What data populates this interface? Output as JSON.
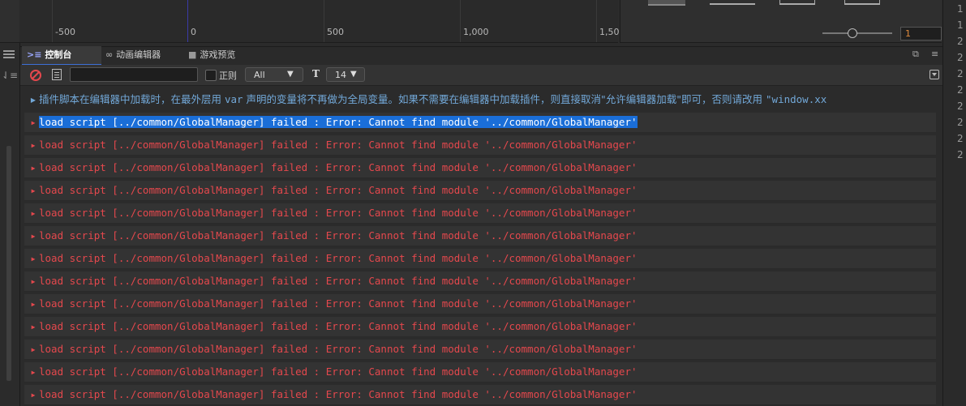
{
  "timeline": {
    "ticks": [
      "-500",
      "0",
      "500",
      "1,000",
      "1,50"
    ]
  },
  "right_panel": {
    "value": "1"
  },
  "right_gutter": {
    "numbers": [
      "1",
      "1",
      "2",
      "2",
      "2",
      "2",
      "2",
      "2",
      "2",
      "2"
    ]
  },
  "tabs": [
    {
      "label": "控制台",
      "icon": "console-icon"
    },
    {
      "label": "动画编辑器",
      "icon": "animation-icon"
    },
    {
      "label": "游戏预览",
      "icon": "video-icon"
    }
  ],
  "toolbar": {
    "filter_value": "",
    "regex_label": "正则",
    "level_value": "All",
    "fontsize_value": "14"
  },
  "log": {
    "info_prefix": "插件脚本在编辑器中加载时，在最外层用 ",
    "info_code": "var",
    "info_suffix": " 声明的变量将不再做为全局变量。如果不需要在编辑器中加载插件，则直接取消\"允许编辑器加载\"即可，否则请改用 ",
    "info_tail": "\"window.xx",
    "errors": [
      "load script [../common/GlobalManager] failed : Error: Cannot find module '../common/GlobalManager'",
      "load script [../common/GlobalManager] failed : Error: Cannot find module '../common/GlobalManager'",
      "load script [../common/GlobalManager] failed : Error: Cannot find module '../common/GlobalManager'",
      "load script [../common/GlobalManager] failed : Error: Cannot find module '../common/GlobalManager'",
      "load script [../common/GlobalManager] failed : Error: Cannot find module '../common/GlobalManager'",
      "load script [../common/GlobalManager] failed : Error: Cannot find module '../common/GlobalManager'",
      "load script [../common/GlobalManager] failed : Error: Cannot find module '../common/GlobalManager'",
      "load script [../common/GlobalManager] failed : Error: Cannot find module '../common/GlobalManager'",
      "load script [../common/GlobalManager] failed : Error: Cannot find module '../common/GlobalManager'",
      "load script [../common/GlobalManager] failed : Error: Cannot find module '../common/GlobalManager'",
      "load script [../common/GlobalManager] failed : Error: Cannot find module '../common/GlobalManager'",
      "load script [../common/GlobalManager] failed : Error: Cannot find module '../common/GlobalManager'",
      "load script [../common/GlobalManager] failed : Error: Cannot find module '../common/GlobalManager'"
    ]
  },
  "colors": {
    "error": "#e5484d",
    "info": "#72a8d8",
    "selection": "#1a6ed8",
    "accent": "#3d6fd6"
  }
}
